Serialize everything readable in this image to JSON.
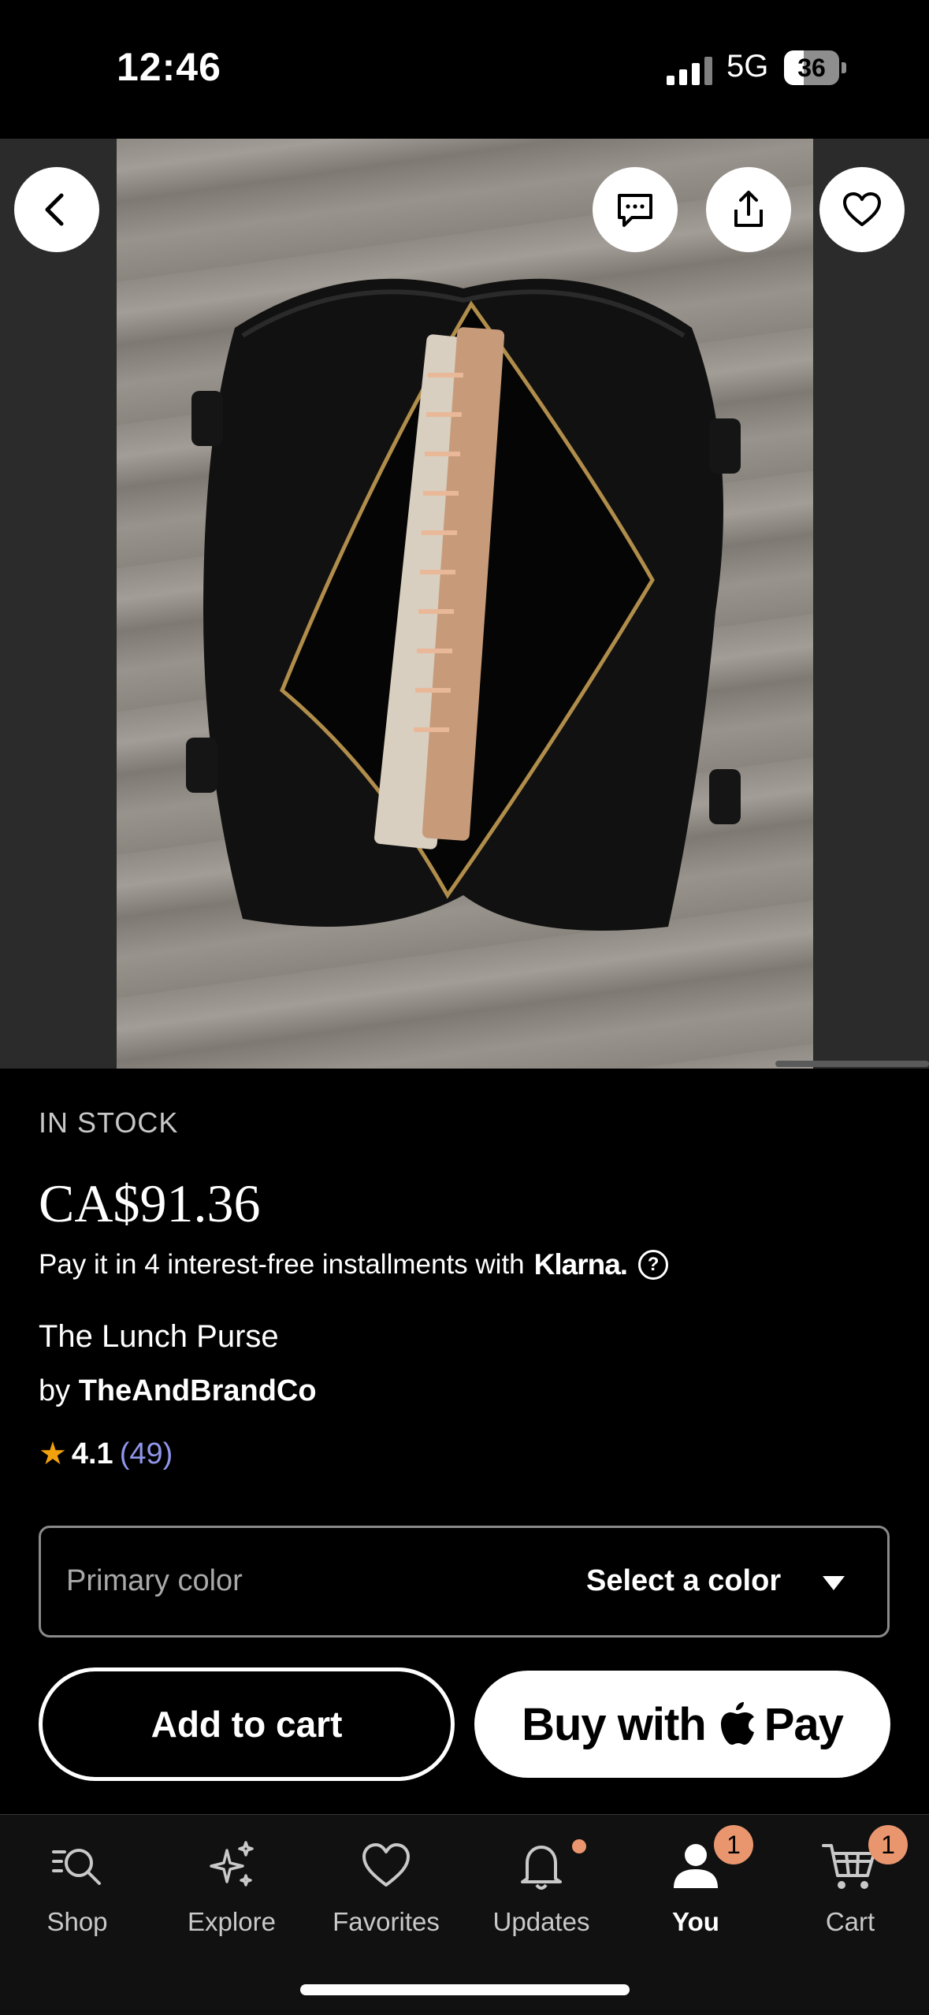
{
  "status_bar": {
    "time": "12:46",
    "network": "5G",
    "battery": "36",
    "battery_level": 0.36
  },
  "product": {
    "stock_status": "IN STOCK",
    "price": "CA$91.36",
    "installments_text": "Pay it in 4 interest-free installments with",
    "installments_brand": "Klarna.",
    "help_glyph": "?",
    "title": "The Lunch Purse",
    "by_prefix": "by",
    "shop_name": "TheAndBrandCo",
    "rating": "4.1",
    "review_count": "(49)"
  },
  "variation": {
    "label": "Primary color",
    "value": "Select a color"
  },
  "actions": {
    "add_to_cart": "Add to cart",
    "buy_with": "Buy with",
    "apple_pay": "Pay"
  },
  "tabs": [
    {
      "label": "Shop",
      "icon": "search-icon"
    },
    {
      "label": "Explore",
      "icon": "sparkle-icon"
    },
    {
      "label": "Favorites",
      "icon": "heart-icon"
    },
    {
      "label": "Updates",
      "icon": "bell-icon"
    },
    {
      "label": "You",
      "icon": "person-icon",
      "badge": "1"
    },
    {
      "label": "Cart",
      "icon": "cart-icon",
      "badge": "1"
    }
  ],
  "colors": {
    "accent_badge": "#e9966f",
    "star": "#f1a10d",
    "review_link": "#8f96e8"
  }
}
